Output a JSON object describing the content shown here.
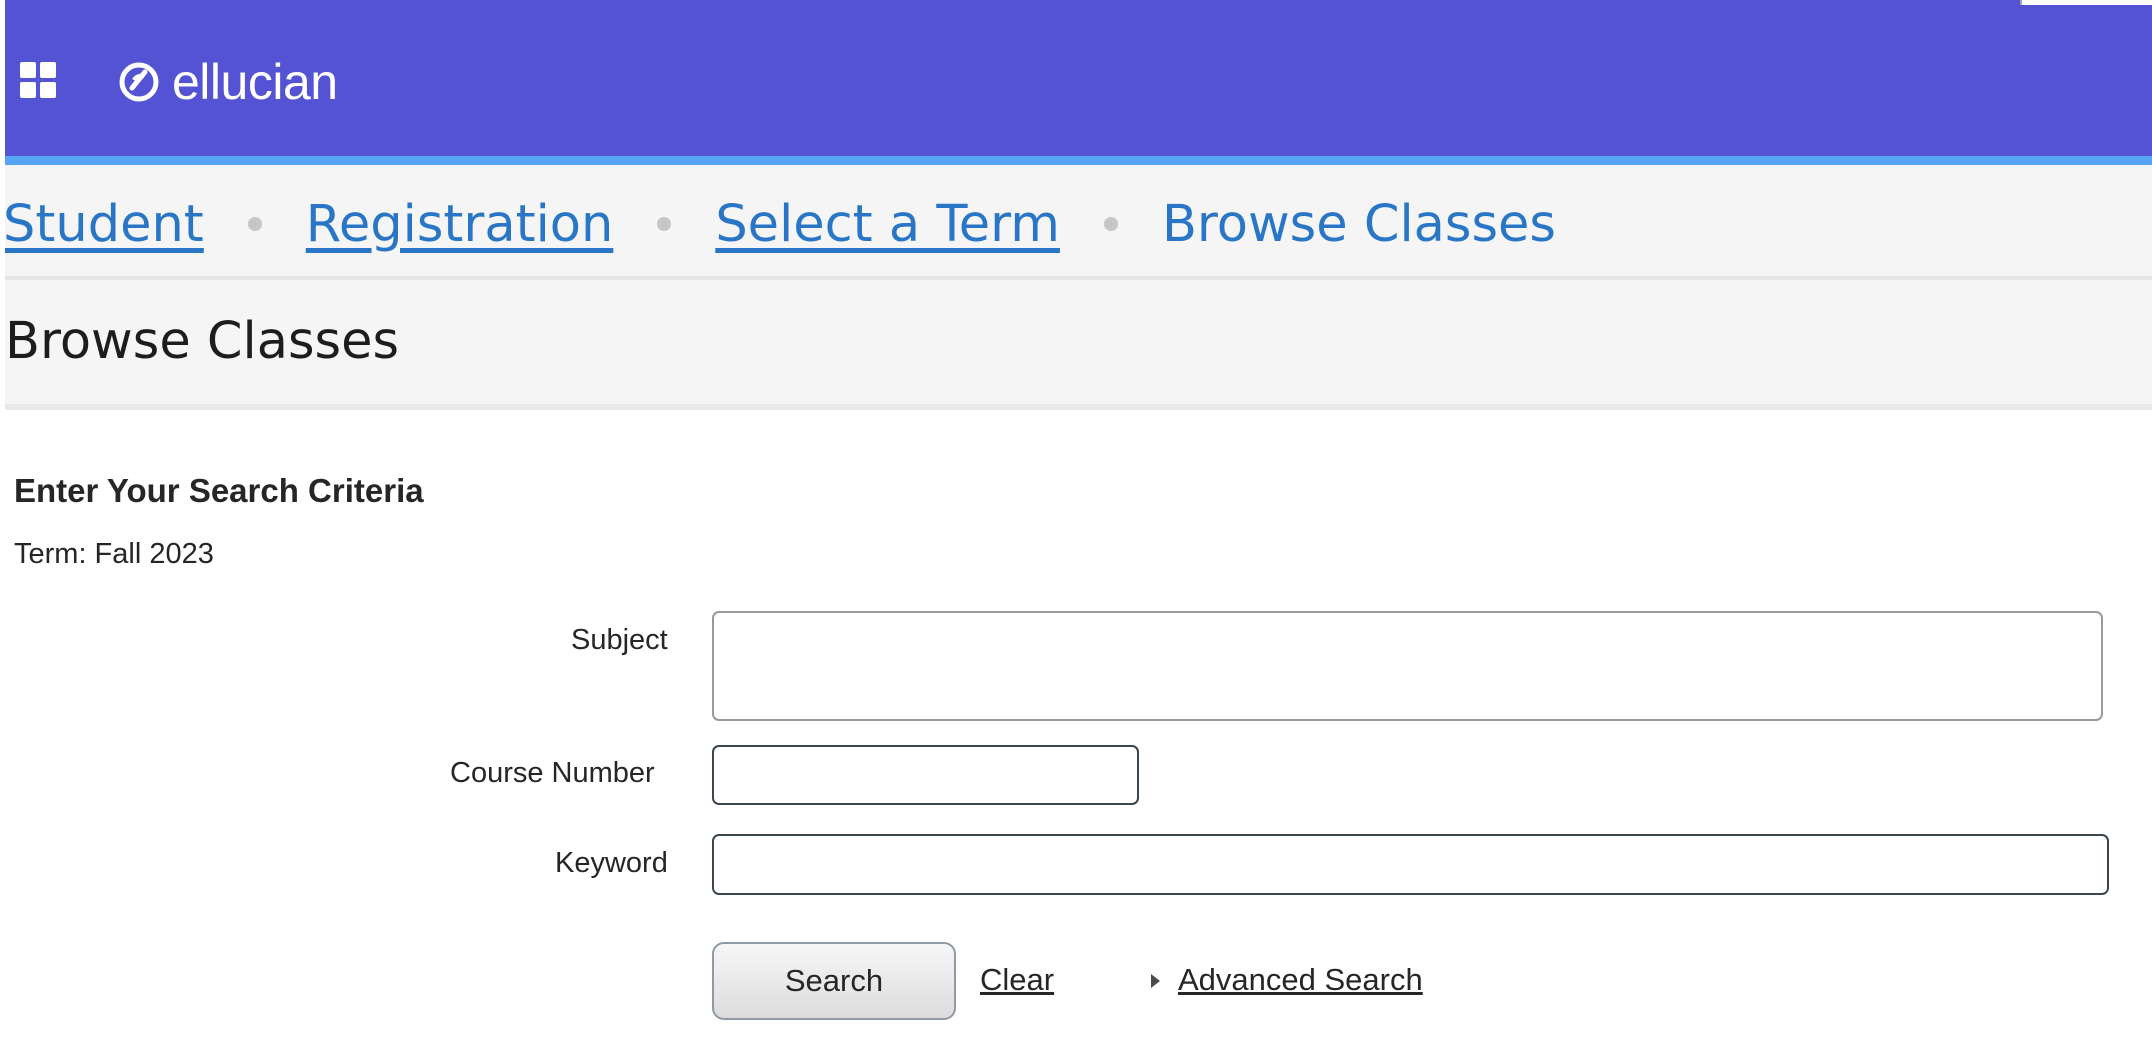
{
  "header": {
    "apps_icon": "grid-apps-icon",
    "logo_icon": "ellucian-logo-icon",
    "brand": "ellucian",
    "brand_color": "#5353d4",
    "accent_color": "#56a5f5"
  },
  "breadcrumb": {
    "items": [
      {
        "label": "Student",
        "link": true
      },
      {
        "label": "Registration",
        "link": true
      },
      {
        "label": "Select a Term",
        "link": true
      },
      {
        "label": "Browse Classes",
        "link": false
      }
    ]
  },
  "page": {
    "title": "Browse Classes"
  },
  "search": {
    "heading": "Enter Your Search Criteria",
    "term": "Term: Fall 2023",
    "subject_label": "Subject",
    "subject_value": "",
    "course_number_label": "Course Number",
    "course_number_value": "",
    "keyword_label": "Keyword",
    "keyword_value": "",
    "search_button": "Search",
    "clear_link": "Clear",
    "advanced_search_link": "Advanced Search"
  }
}
